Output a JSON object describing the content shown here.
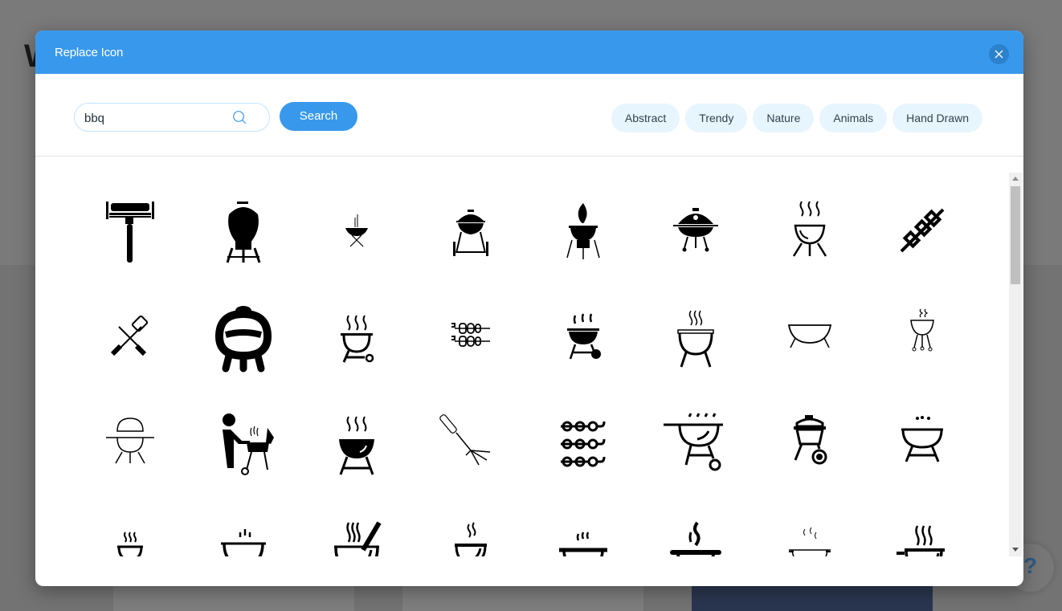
{
  "background": {
    "partial_letter": "W",
    "help_label": "?"
  },
  "modal": {
    "title": "Replace Icon",
    "close_icon": "close-icon"
  },
  "search": {
    "value": "bbq",
    "placeholder": "",
    "button_label": "Search"
  },
  "categories": [
    "Abstract",
    "Trendy",
    "Nature",
    "Animals",
    "Hand Drawn"
  ],
  "icons": [
    {
      "name": "rotisserie-grill-icon"
    },
    {
      "name": "kettle-grill-icon"
    },
    {
      "name": "small-brazier-icon"
    },
    {
      "name": "kettle-grill-wheels-icon"
    },
    {
      "name": "flaming-grill-icon"
    },
    {
      "name": "covered-grill-icon"
    },
    {
      "name": "steaming-grill-outline-icon"
    },
    {
      "name": "kebab-skewer-icon"
    },
    {
      "name": "fork-spatula-crossed-icon"
    },
    {
      "name": "egg-smoker-icon"
    },
    {
      "name": "grill-steam-wheel-icon"
    },
    {
      "name": "double-skewers-icon"
    },
    {
      "name": "black-grill-steam-wheel-icon"
    },
    {
      "name": "double-line-grill-icon"
    },
    {
      "name": "bowl-grill-icon"
    },
    {
      "name": "thin-grill-legs-icon"
    },
    {
      "name": "dome-grill-outline-icon"
    },
    {
      "name": "person-grilling-icon"
    },
    {
      "name": "solid-bowl-grill-icon"
    },
    {
      "name": "carving-fork-icon"
    },
    {
      "name": "three-skewers-icon"
    },
    {
      "name": "steam-grill-wheel-outline-icon"
    },
    {
      "name": "sketch-grill-wheel-icon"
    },
    {
      "name": "sketch-grill-icon"
    },
    {
      "name": "small-steam-grill-icon"
    },
    {
      "name": "hand-drawn-pot-icon"
    },
    {
      "name": "bowl-spoon-steam-icon"
    },
    {
      "name": "steaming-pot-stand-icon"
    },
    {
      "name": "pot-handles-icon"
    },
    {
      "name": "pan-steam-icon"
    },
    {
      "name": "thin-pot-icon"
    },
    {
      "name": "pot-handle-steam-icon"
    }
  ],
  "colors": {
    "accent": "#3899ec",
    "close_bg": "#2b81cb",
    "chip_bg": "#e7f5fe",
    "search_border": "#c1e4fe"
  }
}
